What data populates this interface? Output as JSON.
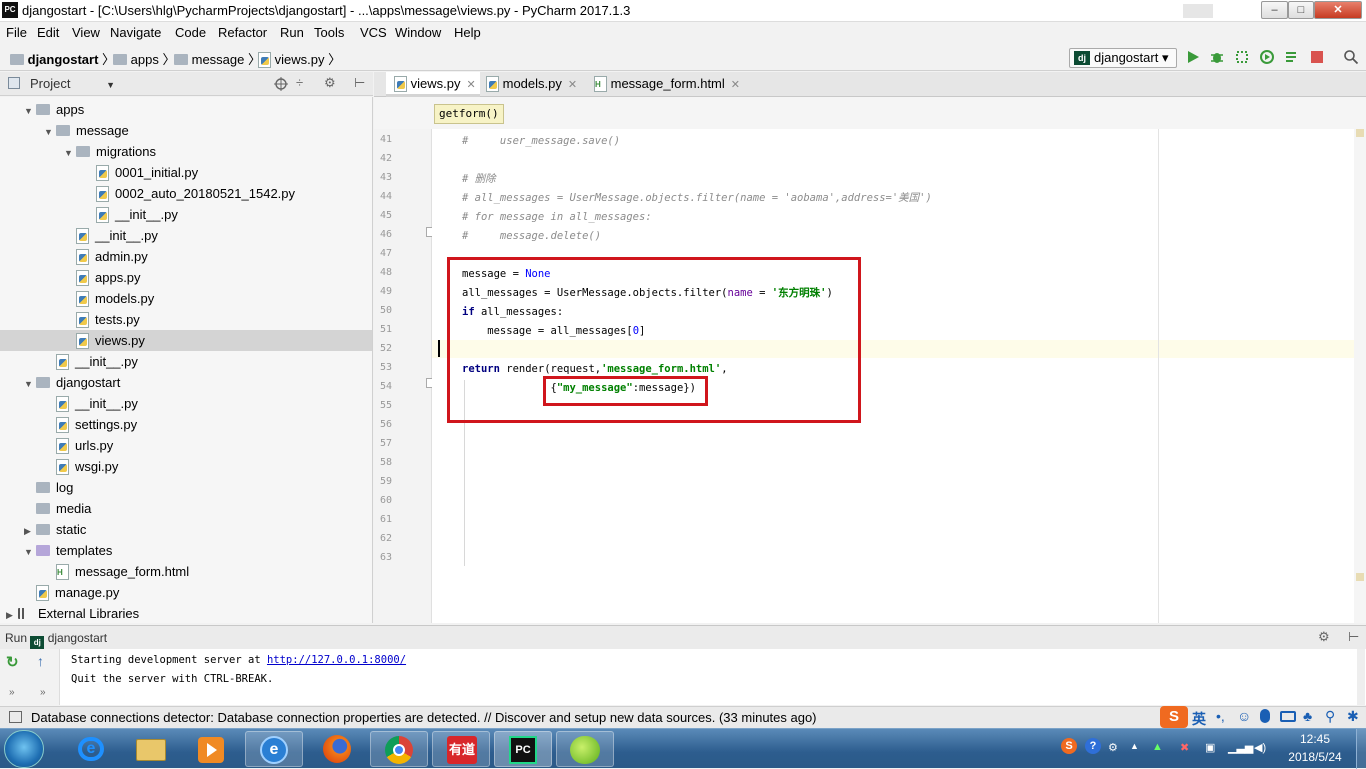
{
  "window": {
    "title": "djangostart - [C:\\Users\\hlg\\PycharmProjects\\djangostart] - ...\\apps\\message\\views.py - PyCharm 2017.1.3",
    "app_icon": "PC"
  },
  "menu": [
    "File",
    "Edit",
    "View",
    "Navigate",
    "Code",
    "Refactor",
    "Run",
    "Tools",
    "VCS",
    "Window",
    "Help"
  ],
  "nav": {
    "crumbs": [
      "djangostart",
      "apps",
      "message",
      "views.py"
    ],
    "run_config": "djangostart"
  },
  "project": {
    "header": "Project",
    "tree": [
      {
        "label": "apps",
        "indent": 1,
        "type": "folder",
        "arrow": "open"
      },
      {
        "label": "message",
        "indent": 2,
        "type": "folder",
        "arrow": "open"
      },
      {
        "label": "migrations",
        "indent": 3,
        "type": "folder",
        "arrow": "open"
      },
      {
        "label": "0001_initial.py",
        "indent": 4,
        "type": "py"
      },
      {
        "label": "0002_auto_20180521_1542.py",
        "indent": 4,
        "type": "py"
      },
      {
        "label": "__init__.py",
        "indent": 4,
        "type": "py"
      },
      {
        "label": "__init__.py",
        "indent": 3,
        "type": "py"
      },
      {
        "label": "admin.py",
        "indent": 3,
        "type": "py"
      },
      {
        "label": "apps.py",
        "indent": 3,
        "type": "py"
      },
      {
        "label": "models.py",
        "indent": 3,
        "type": "py"
      },
      {
        "label": "tests.py",
        "indent": 3,
        "type": "py"
      },
      {
        "label": "views.py",
        "indent": 3,
        "type": "py",
        "selected": true
      },
      {
        "label": "__init__.py",
        "indent": 2,
        "type": "py"
      },
      {
        "label": "djangostart",
        "indent": 1,
        "type": "folder",
        "arrow": "open"
      },
      {
        "label": "__init__.py",
        "indent": 2,
        "type": "py"
      },
      {
        "label": "settings.py",
        "indent": 2,
        "type": "py"
      },
      {
        "label": "urls.py",
        "indent": 2,
        "type": "py"
      },
      {
        "label": "wsgi.py",
        "indent": 2,
        "type": "py"
      },
      {
        "label": "log",
        "indent": 1,
        "type": "folder"
      },
      {
        "label": "media",
        "indent": 1,
        "type": "folder"
      },
      {
        "label": "static",
        "indent": 1,
        "type": "folder",
        "arrow": "closed"
      },
      {
        "label": "templates",
        "indent": 1,
        "type": "folder",
        "arrow": "open",
        "purple": true
      },
      {
        "label": "message_form.html",
        "indent": 2,
        "type": "html"
      },
      {
        "label": "manage.py",
        "indent": 1,
        "type": "py"
      },
      {
        "label": "External Libraries",
        "indent": 0,
        "type": "lib",
        "arrow": "closed"
      }
    ]
  },
  "editor": {
    "tabs": [
      {
        "label": "views.py",
        "active": true,
        "icon": "py"
      },
      {
        "label": "models.py",
        "active": false,
        "icon": "py"
      },
      {
        "label": "message_form.html",
        "active": false,
        "icon": "html"
      }
    ],
    "tooltip": "getform()",
    "lines": [
      {
        "n": "41",
        "html": "<span class=\"cm\">#     user_message.save()</span>"
      },
      {
        "n": "42",
        "html": ""
      },
      {
        "n": "43",
        "html": "<span class=\"cm\"># 删除</span>"
      },
      {
        "n": "44",
        "html": "<span class=\"cm\"># all_messages = UserMessage.objects.filter(name = 'aobama',address='美国')</span>"
      },
      {
        "n": "45",
        "html": "<span class=\"cm\"># for message in all_messages:</span>"
      },
      {
        "n": "46",
        "html": "<span class=\"cm\">#     message.delete()</span>"
      },
      {
        "n": "47",
        "html": ""
      },
      {
        "n": "48",
        "html": "message = <span class=\"nm\">None</span>"
      },
      {
        "n": "49",
        "html": "all_messages = UserMessage.objects.filter(<span class=\"pm\">name</span> = <span class=\"st\">'东方明珠'</span>)"
      },
      {
        "n": "50",
        "html": "<span class=\"kw\">if</span> all_messages:"
      },
      {
        "n": "51",
        "html": "    message = all_messages[<span class=\"nm\">0</span>]"
      },
      {
        "n": "52",
        "html": ""
      },
      {
        "n": "53",
        "html": "<span class=\"kw\">return</span> render(request,<span class=\"st\">'message_form.html'</span>,"
      },
      {
        "n": "54",
        "html": "              {<span class=\"st\">\"my_message\"</span>:message})"
      },
      {
        "n": "55",
        "html": ""
      },
      {
        "n": "56",
        "html": ""
      },
      {
        "n": "57",
        "html": ""
      },
      {
        "n": "58",
        "html": ""
      },
      {
        "n": "59",
        "html": ""
      },
      {
        "n": "60",
        "html": ""
      },
      {
        "n": "61",
        "html": ""
      },
      {
        "n": "62",
        "html": ""
      },
      {
        "n": "63",
        "html": ""
      }
    ]
  },
  "run": {
    "label": "Run",
    "config": "djangostart",
    "output_line1_prefix": "Starting development server at ",
    "output_link": "http://127.0.0.1:8000/",
    "output_line2": "Quit the server with CTRL-BREAK."
  },
  "status": {
    "message": "Database connections detector: Database connection properties are detected. // Discover and setup new data sources. (33 minutes ago)",
    "ime_label": "英"
  },
  "taskbar": {
    "time": "12:45",
    "date": "2018/5/24",
    "apps": [
      "windows-explorer",
      "media-player",
      "internet-explorer",
      "firefox",
      "chrome",
      "youdao",
      "pycharm",
      "green-app"
    ],
    "youdao_label": "有道",
    "pycharm_label": "PC"
  }
}
